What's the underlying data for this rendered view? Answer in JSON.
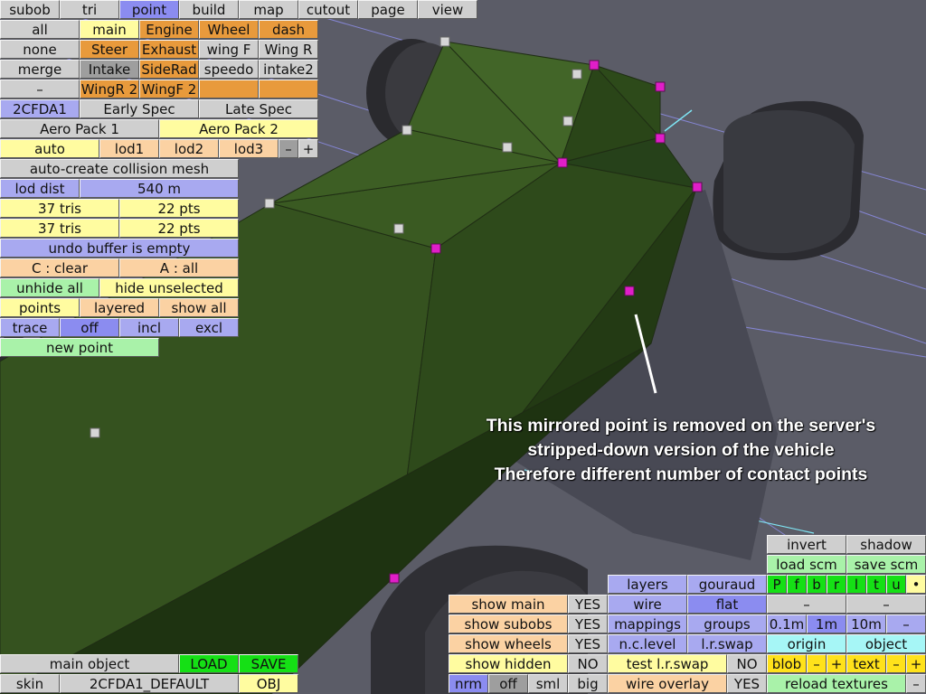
{
  "tabs": [
    "subob",
    "tri",
    "point",
    "build",
    "map",
    "cutout",
    "page",
    "view"
  ],
  "groups": {
    "all": "all",
    "main": "main",
    "engine": "Engine",
    "wheel": "Wheel",
    "dash": "dash",
    "none": "none",
    "steer": "Steer",
    "exhaust": "Exhaust",
    "wing_f": "wing F",
    "wing_r": "Wing R",
    "merge": "merge",
    "intake": "Intake",
    "siderad": "SideRad",
    "speedo": "speedo",
    "intake2": "intake2",
    "dash_minus": "–",
    "wingr2": "WingR 2",
    "wingf2": "WingF 2"
  },
  "specs": {
    "name": "2CFDA1",
    "early": "Early Spec",
    "late": "Late Spec",
    "aero1": "Aero Pack 1",
    "aero2": "Aero Pack 2"
  },
  "lods": {
    "auto": "auto",
    "lod1": "lod1",
    "lod2": "lod2",
    "lod3": "lod3",
    "minus": "–",
    "plus": "+"
  },
  "left_panel": {
    "collision": "auto-create collision mesh",
    "lod_dist_label": "lod dist",
    "lod_dist_value": "540 m",
    "tris1": "37 tris",
    "pts1": "22 pts",
    "tris2": "37 tris",
    "pts2": "22 pts",
    "undo": "undo buffer is empty",
    "clear": "C : clear",
    "select_all": "A : all",
    "unhide": "unhide all",
    "hide_unselected": "hide unselected",
    "points": "points",
    "layered": "layered",
    "show_all": "show all",
    "trace": "trace",
    "off": "off",
    "incl": "incl",
    "excl": "excl",
    "new_point": "new point"
  },
  "bottom_left": {
    "main_object": "main object",
    "load": "LOAD",
    "save": "SAVE",
    "skin": "skin",
    "skin_name": "2CFDA1_DEFAULT",
    "obj": "OBJ"
  },
  "view_panel": {
    "invert": "invert",
    "shadow": "shadow",
    "load_scm": "load scm",
    "save_scm": "save scm",
    "view_letters": [
      "P",
      "f",
      "b",
      "r",
      "l",
      "t",
      "u",
      "•"
    ],
    "dash1": "–",
    "dash2": "–",
    "d01": "0.1m",
    "d1": "1m",
    "d10": "10m",
    "dminus": "–",
    "origin": "origin",
    "object": "object",
    "blob": "blob",
    "blob_minus": "–",
    "blob_plus": "+",
    "text": "text",
    "text_minus": "–",
    "text_plus": "+",
    "reload": "reload textures",
    "reload_minus": "–",
    "layers": "layers",
    "gouraud": "gouraud",
    "wire": "wire",
    "flat": "flat",
    "mappings": "mappings",
    "groups": "groups",
    "nclevel": "n.c.level",
    "lrswap": "l.r.swap",
    "test_lr": "test l.r.swap",
    "test_lr_val": "NO",
    "wire_overlay": "wire overlay",
    "wire_overlay_val": "YES",
    "show_main": "show main",
    "show_main_val": "YES",
    "show_subobs": "show subobs",
    "show_subobs_val": "YES",
    "show_wheels": "show wheels",
    "show_wheels_val": "YES",
    "show_hidden": "show hidden",
    "show_hidden_val": "NO",
    "nrm": "nrm",
    "off": "off",
    "sml": "sml",
    "big": "big"
  },
  "annotation": {
    "line1": "This mirrored point is removed on the server's",
    "line2": "stripped-down version of the vehicle",
    "line3": "Therefore different number of contact points"
  },
  "colors": {
    "background": "#5a5b66",
    "body": "#2f4a1d",
    "selected_point": "#e01ec8",
    "point": "#d8d8d8"
  }
}
